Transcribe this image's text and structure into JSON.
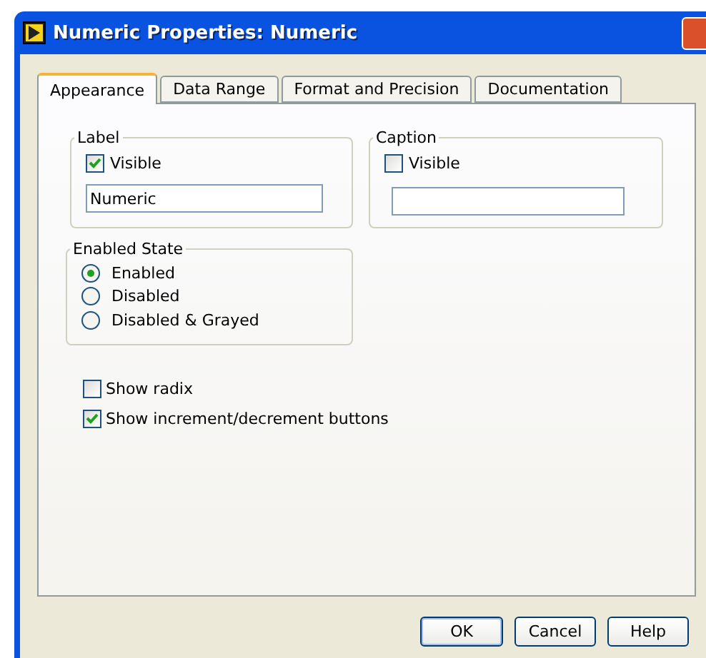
{
  "window": {
    "title": "Numeric Properties: Numeric"
  },
  "tabs": [
    {
      "label": "Appearance",
      "selected": true
    },
    {
      "label": "Data Range",
      "selected": false
    },
    {
      "label": "Format and Precision",
      "selected": false
    },
    {
      "label": "Documentation",
      "selected": false
    }
  ],
  "label_group": {
    "title": "Label",
    "visible_label": "Visible",
    "checked": true,
    "value": "Numeric"
  },
  "caption_group": {
    "title": "Caption",
    "visible_label": "Visible",
    "checked": false
  },
  "enabled_state": {
    "title": "Enabled State",
    "options": [
      {
        "label": "Enabled",
        "selected": true
      },
      {
        "label": "Disabled",
        "selected": false
      },
      {
        "label": "Disabled & Grayed",
        "selected": false
      }
    ]
  },
  "options": [
    {
      "label": "Show radix",
      "checked": false
    },
    {
      "label": "Show increment/decrement buttons",
      "checked": true
    }
  ],
  "buttons": [
    {
      "label": "OK",
      "kind": "default"
    },
    {
      "label": "Cancel",
      "kind": "normal"
    },
    {
      "label": "Help",
      "kind": "normal"
    }
  ]
}
